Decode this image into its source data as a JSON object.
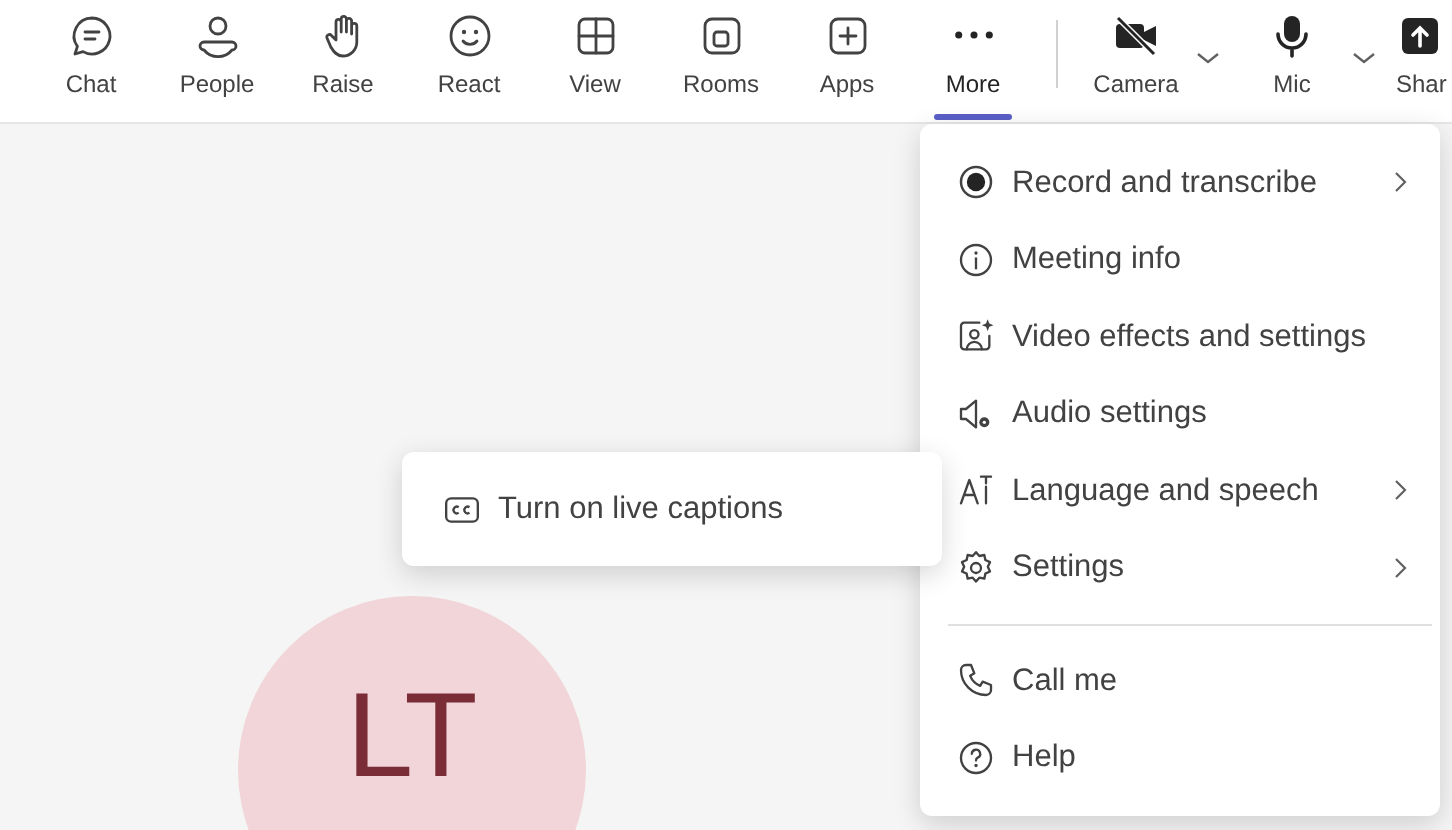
{
  "toolbar": [
    {
      "label": "Chat",
      "selected": false
    },
    {
      "label": "People",
      "selected": false
    },
    {
      "label": "Raise",
      "selected": false
    },
    {
      "label": "React",
      "selected": false
    },
    {
      "label": "View",
      "selected": false
    },
    {
      "label": "Rooms",
      "selected": false
    },
    {
      "label": "Apps",
      "selected": false
    },
    {
      "label": "More",
      "selected": true
    }
  ],
  "devices": [
    {
      "label": "Camera",
      "dropdown": true
    },
    {
      "label": "Mic",
      "dropdown": true
    },
    {
      "label": "Shar",
      "dropdown": false
    }
  ],
  "more_menu": {
    "groups": [
      [
        {
          "label": "Record and transcribe",
          "submenu": true
        },
        {
          "label": "Meeting info",
          "submenu": false
        },
        {
          "label": "Video effects and settings",
          "submenu": false
        },
        {
          "label": "Audio settings",
          "submenu": false
        },
        {
          "label": "Language and speech",
          "submenu": true
        },
        {
          "label": "Settings",
          "submenu": true
        }
      ],
      [
        {
          "label": "Call me",
          "submenu": false
        },
        {
          "label": "Help",
          "submenu": false
        }
      ]
    ]
  },
  "submenu": {
    "items": [
      {
        "label": "Turn on live captions"
      }
    ]
  },
  "participant": {
    "initials": "LT"
  }
}
